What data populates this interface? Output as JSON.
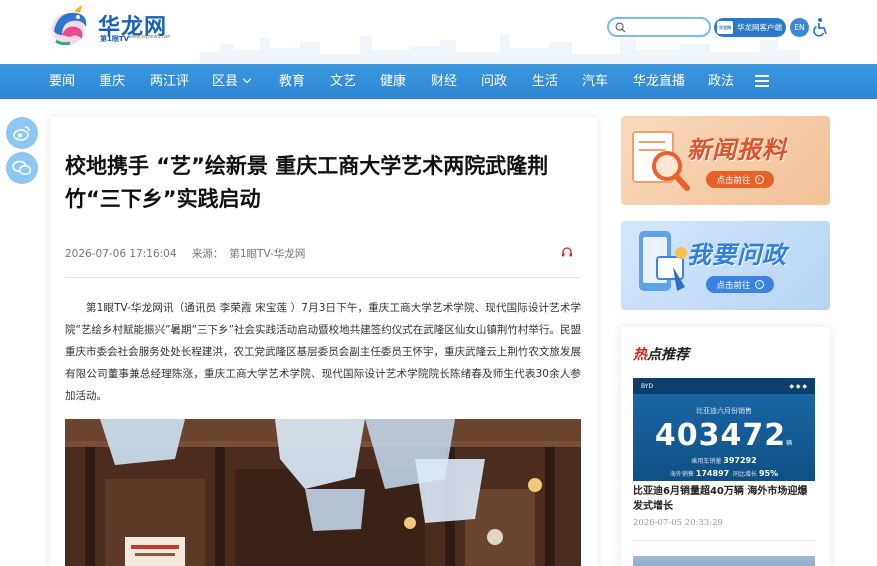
{
  "header": {
    "logo_text": "华龙网",
    "logo_sub": "第1眼TV",
    "logo_url": "www.cqnews.net",
    "search_placeholder": "",
    "client_label": "华龙网客户端",
    "client_mini": "华龙网",
    "lang_label": "EN"
  },
  "nav": {
    "items": [
      "要闻",
      "重庆",
      "两江评",
      "区县",
      "教育",
      "文艺",
      "健康",
      "财经",
      "问政",
      "生活",
      "汽车",
      "华龙直播",
      "政法"
    ]
  },
  "article": {
    "title": "校地携手 “艺”绘新景 重庆工商大学艺术两院武隆荆竹“三下乡”实践启动",
    "date": "2026-07-06 17:16:04",
    "source_label": "来源：",
    "source": "第1眼TV-华龙网",
    "body": "第1眼TV-华龙网讯（通讯员 李荣霞 宋宝莲 ）7月3日下午，重庆工商大学艺术学院、现代国际设计艺术学院“艺绘乡村赋能振兴”暑期“三下乡”社会实践活动启动暨校地共建签约仪式在武隆区仙女山镇荆竹村举行。民盟重庆市委会社会服务处处长程建洪，农工党武隆区基层委员会副主任委员王怀宇，重庆武隆云上荆竹农文旅发展有限公司董事兼总经理陈涨，重庆工商大学艺术学院、现代国际设计艺术学院院长陈绪春及师生代表30余人参加活动。"
  },
  "sidebar": {
    "banner1_title": "新闻报料",
    "banner1_btn": "点击前往",
    "banner2_title": "我要问政",
    "banner2_btn": "点击前往",
    "hot_title_first": "热",
    "hot_title_rest": "点推荐",
    "hot_img_brand": "BYD",
    "hot_img_sub": "比亚迪六月份销售",
    "hot_img_number": "403472",
    "hot_img_unit": "辆",
    "hot_img_stat1_label": "乘用车销量",
    "hot_img_stat1_value": "397292",
    "hot_img_stat2_label": "海外销售",
    "hot_img_stat2_value": "174897",
    "hot_img_stat2_pct_label": "同比增长",
    "hot_img_stat2_pct": "95%",
    "hot_headline": "比亚迪6月销量超40万辆 海外市场迎爆发式增长",
    "hot_date": "2026-07-05 20:33:29"
  },
  "colors": {
    "nav_bg": "#3291d8",
    "brand_blue": "#1463b8",
    "hot_red": "#d9261c",
    "report_orange": "#e0532a"
  }
}
